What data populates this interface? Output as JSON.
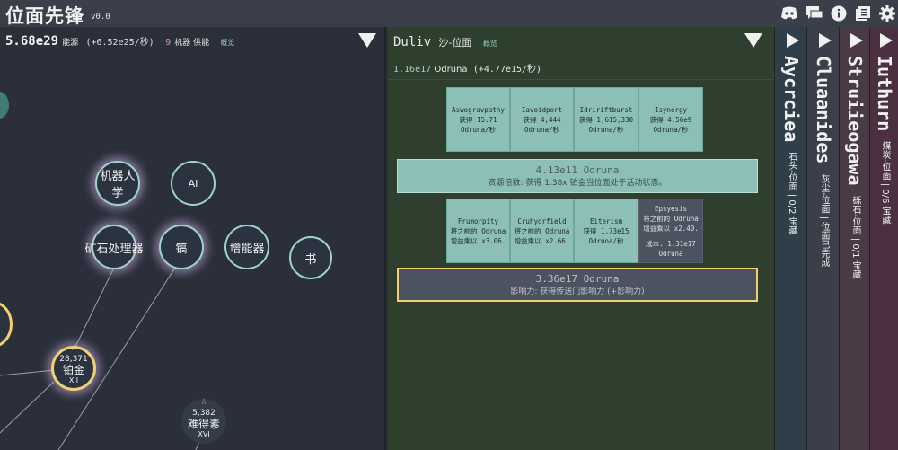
{
  "app": {
    "title": "位面先锋",
    "version": "v0.0"
  },
  "left": {
    "energy": "5.68e29",
    "energy_label": "能源",
    "energy_rate": "(+6.52e25/秒)",
    "machines_count": "9",
    "machines_label": "机器 供能",
    "overview": "概览",
    "nodes": {
      "robot": "机器人学",
      "ai": "AI",
      "ore": "矿石处理器",
      "tungsten": "镐",
      "booster": "增能器",
      "book": "书",
      "platinum": {
        "count": "28,371",
        "name": "铂金",
        "roman": "XII"
      },
      "rare": {
        "count": "5,382",
        "name": "难得素",
        "roman": "XVI"
      }
    }
  },
  "middle": {
    "plane": "Duliv",
    "plane_type": "沙-位面",
    "overview": "概览",
    "resource_value": "1.16e17",
    "resource_name": "Odruna",
    "resource_rate": "(+4.77e15/秒)",
    "cards_row1": [
      {
        "name": "Aswogravpathy",
        "l1": "获得 15.71",
        "l2": "Odruna/秒"
      },
      {
        "name": "Iavoidport",
        "l1": "获得 4,444",
        "l2": "Odruna/秒"
      },
      {
        "name": "Idririftburst",
        "l1": "获得 1,615,330",
        "l2": "Odruna/秒"
      },
      {
        "name": "Isynergy",
        "l1": "获得 4.56e9",
        "l2": "Odruna/秒"
      }
    ],
    "bar1": {
      "value": "4.13e11 Odruna",
      "desc": "资源倍数: 获得 1.38x 铂金当位面处于活动状态。"
    },
    "cards_row2": [
      {
        "name": "Frumorpity",
        "l1": "将之前的 Odruna",
        "l2": "增益乘以 x3.06."
      },
      {
        "name": "Cruhydrfield",
        "l1": "将之前的 Odruna",
        "l2": "增益乘以 x2.66."
      },
      {
        "name": "Eiterism",
        "l1": "获得 1.73e15",
        "l2": "Odruna/秒"
      },
      {
        "name": "Epsyesis",
        "l1": "将之前的 Odruna",
        "l2": "增益乘以 x2.40.",
        "l3": "成本: 1.31e17",
        "l4": "Odruna"
      }
    ],
    "bar2": {
      "value": "3.36e17 Odruna",
      "desc": "影响力: 获得传送门影响力 (+影响力)"
    }
  },
  "side_panels": [
    {
      "name": "Aycrciea",
      "sub": "石头-位面 | 0/2 宝藏",
      "color": "#2f3f4a"
    },
    {
      "name": "Cluaanides",
      "sub": "灰尘-位面 | 位面已完成",
      "color": "#3a3f4a"
    },
    {
      "name": "Struiieogawa",
      "sub": "砾石-位面 | 0/1 宝藏",
      "color": "#4a3a44"
    },
    {
      "name": "Iuthurn",
      "sub": "煤炭-位面 | 0/6 宝藏",
      "color": "#4a3040"
    }
  ],
  "colors": {
    "accent": "#9fd3cc",
    "highlight": "#f0d070",
    "glow": "#c790c8"
  }
}
